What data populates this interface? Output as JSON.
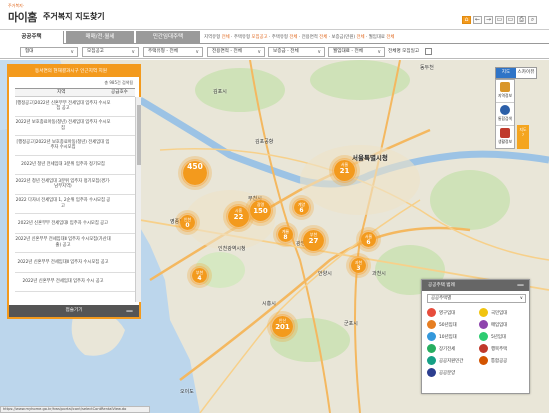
{
  "header": {
    "logo_sub": "주거복지·",
    "logo_text": "마이홈",
    "title": "주거복지 지도찾기",
    "tools": [
      "⌂",
      "←",
      "→",
      "▭",
      "▭",
      "⎙",
      "⌕"
    ]
  },
  "tabs": [
    {
      "label": "공공주택",
      "active": true
    },
    {
      "label": "매매/전·월세",
      "active": false
    },
    {
      "label": "민간임대주택",
      "active": false
    }
  ],
  "breadcrumb": [
    {
      "text": "지역유형 ",
      "hl": "전체"
    },
    {
      "text": " · 주택유형 ",
      "hl": "모집공고"
    },
    {
      "text": " · 주택유형 ",
      "hl": "전체"
    },
    {
      "text": " · 전용면적 ",
      "hl": "전체"
    },
    {
      "text": " · 보증금(만원) ",
      "hl": "전체"
    },
    {
      "text": " · 월임대료 ",
      "hl": "전체"
    }
  ],
  "filters": {
    "region": "협대",
    "notice": "모집공고",
    "house_type": "주택유형 - 전체",
    "area": "전용면적 - 전체",
    "deposit": "보증금 - 전체",
    "rent": "월임대료 - 전체",
    "checkbox_label": "전체명 모집일고"
  },
  "list_panel": {
    "title": "동서면의 현재결과시구 인근지역 지원",
    "sort_label": "총 985건 검색됨",
    "col_region": "지역",
    "col_count": "공급호수",
    "rows": [
      {
        "name": "[행정공고]2022년 신혼부부 전세임대 입주자 수시모집 공고",
        "count": ""
      },
      {
        "name": "2022년 보호종료아동(청년) 전세임대 입주자 수시모집",
        "count": ""
      },
      {
        "name": "[행정공고]2022년 보호종료아동(청년) 전세임대 입주자 수시모집",
        "count": ""
      },
      {
        "name": "2022년 청년 전세임대 3분위 입주자 정기모집",
        "count": ""
      },
      {
        "name": "2022년 청년 전세임대 3분위 입주자 정기모집(경기·남부지역)",
        "count": ""
      },
      {
        "name": "2022 다자녀 전세임대 1, 2순위 입주자 수시모집 공고",
        "count": ""
      },
      {
        "name": "2022년 신혼부부 전세임대Ⅰ 입주자 수시모집 공고",
        "count": ""
      },
      {
        "name": "2022년 신혼부부 전세임대Ⅱ 입주자 수시모집(가산대출) 공고",
        "count": ""
      },
      {
        "name": "2022년 신혼부부 전세임대Ⅱ 입주자 수시모집 공고",
        "count": ""
      },
      {
        "name": "2022년 신혼부부 전세임대 입주자 수시 공고",
        "count": ""
      }
    ],
    "footer": "접슬기기",
    "footer_icon": "—"
  },
  "map_type": {
    "map": "지도",
    "sky": "스카이뷰"
  },
  "right_tools": [
    {
      "label": "지역정보",
      "icon": "person-icon",
      "color": "#d9962a"
    },
    {
      "label": "통합검색",
      "icon": "globe-icon",
      "color": "#2b5fa8"
    },
    {
      "label": "생활정보",
      "icon": "building-icon",
      "color": "#c0392b"
    }
  ],
  "zoom_label": "지도\n7",
  "map_labels": [
    {
      "text": "김포시",
      "size": "n"
    },
    {
      "text": "동두천",
      "size": "n"
    },
    {
      "text": "부천시",
      "size": "n"
    },
    {
      "text": "서울특별시청",
      "size": "big"
    },
    {
      "text": "인천광역시청",
      "size": "n"
    },
    {
      "text": "시흥시",
      "size": "n"
    },
    {
      "text": "안양시",
      "size": "n"
    },
    {
      "text": "과천시",
      "size": "n"
    },
    {
      "text": "군포시",
      "size": "n"
    },
    {
      "text": "광명",
      "size": "n"
    },
    {
      "text": "김포공항",
      "size": "n"
    },
    {
      "text": "영종도",
      "size": "n"
    },
    {
      "text": "오이도",
      "size": "n"
    }
  ],
  "clusters": [
    {
      "name": "",
      "value": "450",
      "size": "lg"
    },
    {
      "name": "서울",
      "value": "21",
      "size": "md"
    },
    {
      "name": "광명",
      "value": "150",
      "size": "md"
    },
    {
      "name": "부천",
      "value": "27",
      "size": "md"
    },
    {
      "name": "시흥",
      "value": "22",
      "size": "md"
    },
    {
      "name": "서울",
      "value": "6",
      "size": "sm"
    },
    {
      "name": "과천",
      "value": "3",
      "size": "sm"
    },
    {
      "name": "인천",
      "value": "0",
      "size": "sm"
    },
    {
      "name": "부천",
      "value": "4",
      "size": "sm"
    },
    {
      "name": "계양",
      "value": "6",
      "size": "sm"
    },
    {
      "name": "계룡",
      "value": "8",
      "size": "sm"
    },
    {
      "name": "안산",
      "value": "201",
      "size": "md"
    }
  ],
  "legend": {
    "title": "공공주택 범례",
    "collapse_icon": "—",
    "select": "공공주택별",
    "items": [
      {
        "label": "영구임대",
        "color": "#e74c3c"
      },
      {
        "label": "국민임대",
        "color": "#f1c40f"
      },
      {
        "label": "50년임대",
        "color": "#e67e22"
      },
      {
        "label": "매입임대",
        "color": "#8e44ad"
      },
      {
        "label": "10년임대",
        "color": "#3498db"
      },
      {
        "label": "5년임대",
        "color": "#2ecc71"
      },
      {
        "label": "장기전세",
        "color": "#27ae60"
      },
      {
        "label": "행복주택",
        "color": "#c0392b"
      },
      {
        "label": "공공지원민간",
        "color": "#16a085"
      },
      {
        "label": "통합공공",
        "color": "#d35400"
      },
      {
        "label": "공공분양",
        "color": "#2c3e8f"
      }
    ]
  },
  "url": "https://www.myhome.go.kr/hws/portal/cont/selectContRentalView.do"
}
